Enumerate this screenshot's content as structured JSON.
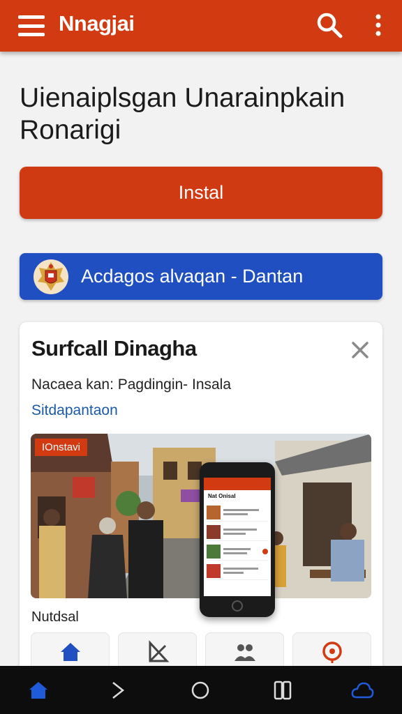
{
  "app": {
    "title": "Nnagjai"
  },
  "headline": "Uienaiplsgan Unarainpkain Ronarigi",
  "install_button": {
    "label": "Instal"
  },
  "promo": {
    "label": "Acdagos alvaqan - Dantan"
  },
  "card": {
    "title": "Surfcall Dinagha",
    "subtitle": "Nacaea kan: Pagdingin- Insala",
    "link": "Sitdapantaon",
    "photo_badge": "IOnstavi",
    "section_label": "Nutdsal",
    "phone_screen_title": "Nat Onisal"
  },
  "colors": {
    "brand": "#d23a12",
    "promo": "#1f4fc1",
    "link": "#1a5aa8",
    "nav_active": "#1f5ad8"
  },
  "tiles": [
    {
      "icon": "home-icon"
    },
    {
      "icon": "scissors-icon"
    },
    {
      "icon": "people-icon"
    },
    {
      "icon": "target-icon"
    }
  ],
  "bottom_nav": [
    {
      "icon": "home-icon",
      "active": true
    },
    {
      "icon": "forward-icon",
      "active": false
    },
    {
      "icon": "circle-home-icon",
      "active": false
    },
    {
      "icon": "recents-icon",
      "active": false
    },
    {
      "icon": "cloud-icon",
      "active": true
    }
  ]
}
